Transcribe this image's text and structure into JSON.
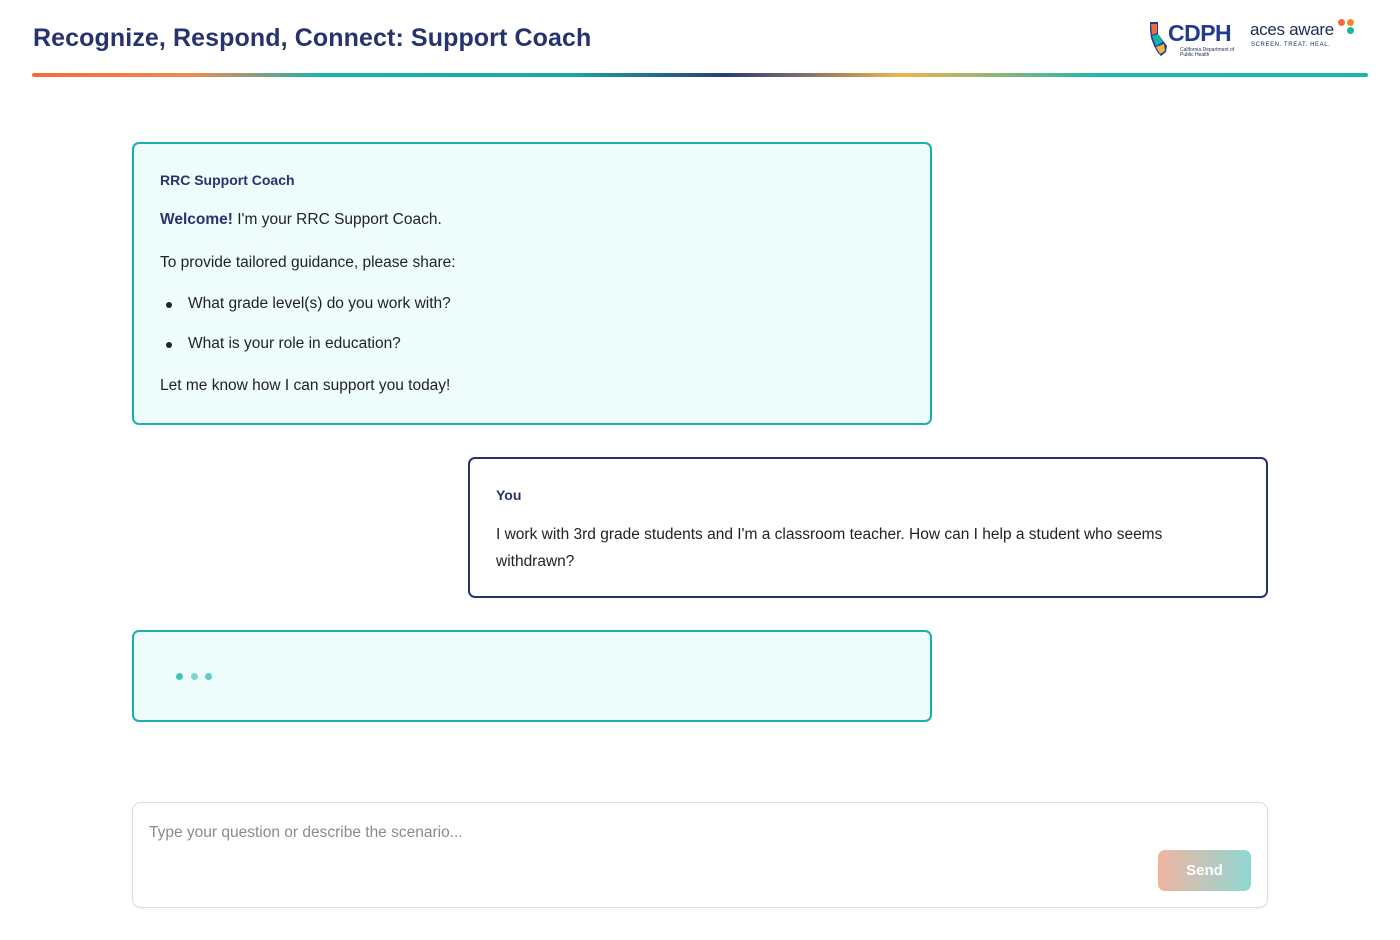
{
  "header": {
    "title": "Recognize, Respond, Connect: Support Coach",
    "logos": {
      "cdph": {
        "name": "CDPH",
        "subtitle": "California Department of Public Health"
      },
      "aces": {
        "name": "aces aware",
        "tagline": "SCREEN. TREAT. HEAL."
      }
    }
  },
  "messages": [
    {
      "role": "coach",
      "sender": "RRC Support Coach",
      "welcome_strong": "Welcome!",
      "welcome_rest": " I'm your RRC Support Coach.",
      "prompt": "To provide tailored guidance, please share:",
      "questions": [
        "What grade level(s) do you work with?",
        "What is your role in education?"
      ],
      "closing": "Let me know how I can support you today!"
    },
    {
      "role": "user",
      "sender": "You",
      "text": "I work with 3rd grade students and I'm a classroom teacher. How can I help a student who seems withdrawn?"
    }
  ],
  "typing_indicator": {
    "state": "loading"
  },
  "composer": {
    "placeholder": "Type your question or describe the scenario...",
    "value": "",
    "send_label": "Send"
  },
  "colors": {
    "primary_navy": "#26336e",
    "teal": "#17b2a8",
    "coach_bg": "#effcfc",
    "orange": "#f26a3d"
  }
}
